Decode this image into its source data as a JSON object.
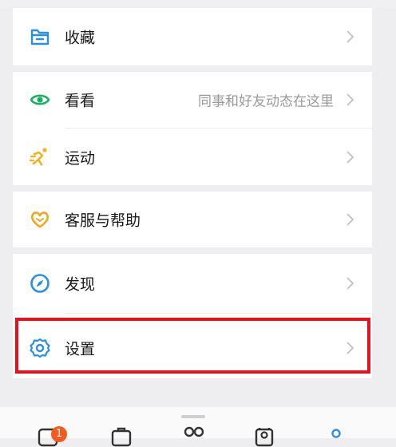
{
  "menu": {
    "favorites": {
      "label": "收藏",
      "icon": "folder-icon",
      "color": "#2b8fe5"
    },
    "moments": {
      "label": "看看",
      "extra": "同事和好友动态在这里",
      "icon": "eye-icon",
      "color": "#17b15c"
    },
    "sports": {
      "label": "运动",
      "icon": "running-person-icon",
      "color": "#f2b21b"
    },
    "support": {
      "label": "客服与帮助",
      "icon": "heart-icon",
      "color": "#f2a51e"
    },
    "discover": {
      "label": "发现",
      "icon": "compass-icon",
      "color": "#2b8fe5"
    },
    "settings": {
      "label": "设置",
      "icon": "gear-icon",
      "color": "#2b8fe5"
    }
  },
  "tabbar": {
    "messages_badge": "1",
    "tabs": [
      "messages-tab",
      "workbench-tab",
      "apps-tab",
      "contacts-tab",
      "me-tab"
    ]
  },
  "highlight_color": "#e8101c"
}
